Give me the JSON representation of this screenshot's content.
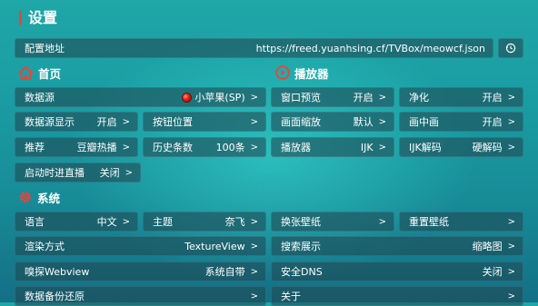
{
  "page": {
    "title": "设置",
    "accent_color": "#e8443a"
  },
  "config": {
    "label": "配置地址",
    "url": "https://freed.yuanhsing.cf/TVBox/meowcf.json",
    "history_icon": "history-clock-icon"
  },
  "home": {
    "title": "首页",
    "icon": "home-icon",
    "source": {
      "label": "数据源",
      "value": "小苹果(SP)",
      "badge_icon": "red-ball-icon"
    },
    "source_display": {
      "label": "数据源显示",
      "value": "开启"
    },
    "button_position": {
      "label": "按钮位置",
      "value": ""
    },
    "recommend": {
      "label": "推荐",
      "value": "豆瓣热播"
    },
    "history_count": {
      "label": "历史条数",
      "value": "100条"
    },
    "startup_live": {
      "label": "启动时进直播",
      "value": "关闭"
    }
  },
  "player": {
    "title": "播放器",
    "icon": "play-circle-icon",
    "window_preview": {
      "label": "窗口预览",
      "value": "开启"
    },
    "purify": {
      "label": "净化",
      "value": "开启"
    },
    "scale": {
      "label": "画面缩放",
      "value": "默认"
    },
    "pip": {
      "label": "画中画",
      "value": "开启"
    },
    "player": {
      "label": "播放器",
      "value": "IJK"
    },
    "ijk_decode": {
      "label": "IJK解码",
      "value": "硬解码"
    }
  },
  "system": {
    "title": "系统",
    "icon": "gear-icon",
    "language": {
      "label": "语言",
      "value": "中文"
    },
    "theme": {
      "label": "主题",
      "value": "奈飞"
    },
    "change_wallpaper": {
      "label": "换张壁纸",
      "value": ""
    },
    "reset_wallpaper": {
      "label": "重置壁纸",
      "value": ""
    },
    "render": {
      "label": "渲染方式",
      "value": "TextureView"
    },
    "search_display": {
      "label": "搜索展示",
      "value": "缩略图"
    },
    "sniff": {
      "label": "嗅探Webview",
      "value": "系统自带"
    },
    "dns": {
      "label": "安全DNS",
      "value": "关闭"
    },
    "backup": {
      "label": "数据备份还原",
      "value": ""
    },
    "about": {
      "label": "关于",
      "value": ""
    }
  },
  "chevron": ">"
}
